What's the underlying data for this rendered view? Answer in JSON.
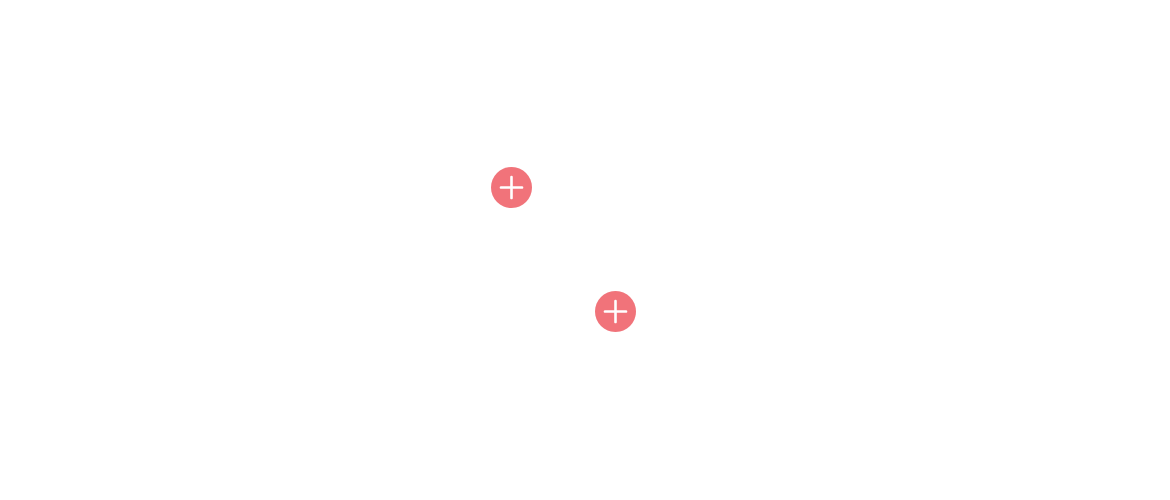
{
  "theme": {
    "background": "#ffffff",
    "accent": "#f1737a",
    "icon_color": "#ffffff"
  },
  "hotspots": [
    {
      "icon": "plus-icon"
    },
    {
      "icon": "plus-icon"
    }
  ]
}
